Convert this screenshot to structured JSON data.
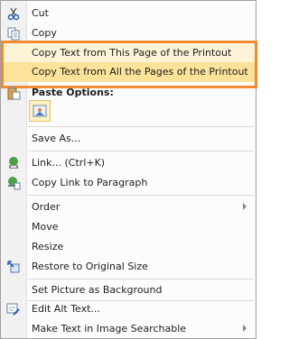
{
  "menu": {
    "items": [
      {
        "label": "Cut",
        "icon": "scissors-icon"
      },
      {
        "label": "Copy",
        "icon": "copy-icon"
      },
      {
        "label": "Copy Text from This Page of the Printout"
      },
      {
        "label": "Copy Text from All the Pages of the Printout"
      },
      {
        "label": "Paste Options:",
        "icon": "paste-icon"
      },
      {
        "label": "Save As..."
      },
      {
        "label": "Link...    (Ctrl+K)",
        "icon": "link-icon"
      },
      {
        "label": "Copy Link to Paragraph",
        "icon": "link-paragraph-icon"
      },
      {
        "label": "Order"
      },
      {
        "label": "Move"
      },
      {
        "label": "Resize"
      },
      {
        "label": "Restore to Original Size",
        "icon": "restore-size-icon"
      },
      {
        "label": "Set Picture as Background"
      },
      {
        "label": "Edit Alt Text...",
        "icon": "alt-text-icon"
      },
      {
        "label": "Make Text in Image Searchable"
      }
    ]
  },
  "colors": {
    "highlight_border": "#f28a30",
    "selected_fill": "#fbe39a"
  }
}
